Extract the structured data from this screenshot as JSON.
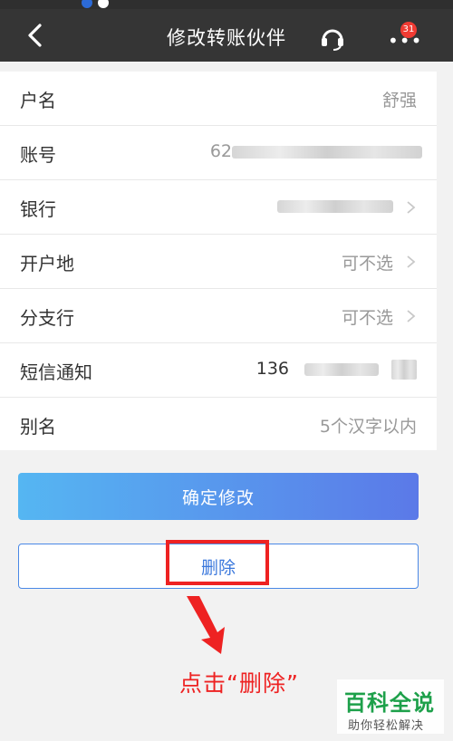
{
  "header": {
    "title": "修改转账伙伴",
    "badge_count": "31"
  },
  "form": {
    "rows": [
      {
        "label": "户名",
        "value": "舒强"
      },
      {
        "label": "账号",
        "value": "62"
      },
      {
        "label": "银行",
        "value": ""
      },
      {
        "label": "开户地",
        "value": "可不选"
      },
      {
        "label": "分支行",
        "value": "可不选"
      },
      {
        "label": "短信通知",
        "value": "136"
      },
      {
        "label": "别名",
        "value": "5个汉字以内"
      }
    ]
  },
  "actions": {
    "confirm_label": "确定修改",
    "delete_label": "删除"
  },
  "annotation": {
    "text": "点击“删除”",
    "color": "#ee2222"
  },
  "watermark": {
    "title": "百科全说",
    "subtitle": "助你轻松解决"
  },
  "colors": {
    "navbar": "#353535",
    "confirm_gradient_start": "#55b6f2",
    "confirm_gradient_end": "#5b79e8",
    "delete_text": "#3b78dc",
    "badge": "#f03b33",
    "watermark_green": "#1da04a"
  }
}
